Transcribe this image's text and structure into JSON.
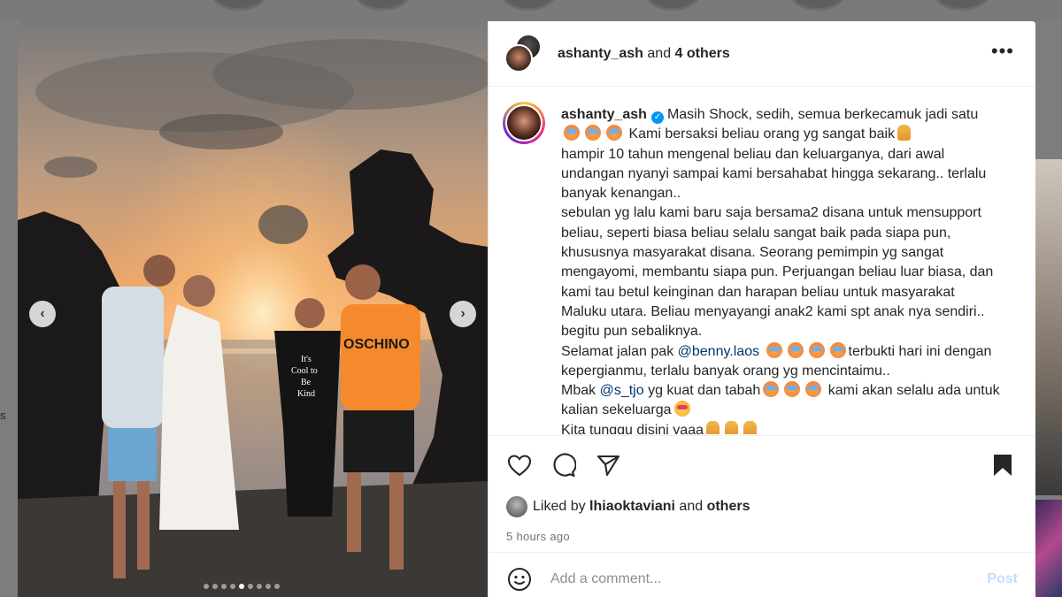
{
  "header": {
    "username": "ashanty_ash",
    "connector": "and",
    "others": "4 others",
    "more_label": "•••"
  },
  "photo": {
    "shirt_text": "It's Cool to Be Kind",
    "shirt2_text": "MOSCHINO",
    "prev_label": "‹",
    "next_label": "›",
    "carousel_dots": 9,
    "active_dot": 5
  },
  "caption": {
    "username": "ashanty_ash",
    "verified_mark": "✓",
    "line1": "Masih Shock, sedih, semua berkecamuk jadi satu",
    "line2": "Kami bersaksi beliau orang yg sangat baik",
    "line3": "hampir 10 tahun mengenal beliau dan keluarganya, dari awal undangan nyanyi sampai kami bersahabat hingga sekarang.. terlalu banyak kenangan..",
    "line4": "sebulan yg lalu kami baru saja bersama2 disana untuk mensupport beliau, seperti biasa beliau selalu sangat baik pada siapa pun, khususnya masyarakat disana. Seorang pemimpin yg sangat mengayomi, membantu siapa pun. Perjuangan beliau luar biasa, dan kami tau betul keinginan dan harapan beliau untuk masyarakat Maluku utara. Beliau menyayangi anak2 kami spt anak nya sendiri.. begitu pun sebaliknya.",
    "line5a": "Selamat jalan pak",
    "mention1": "@benny.laos",
    "line5b": "terbukti hari ini dengan kepergianmu, terlalu banyak orang yg mencintaimu..",
    "line6a": "Mbak",
    "mention2": "@s_tjo",
    "line6b": "yg kuat dan tabah",
    "line6c": "kami akan selalu ada untuk kalian sekeluarga",
    "line7": "Kita tunggu disini yaaa"
  },
  "actions": {
    "liked_prefix": "Liked by",
    "liked_user": "lhiaoktaviani",
    "liked_and": "and",
    "liked_others": "others",
    "timestamp": "5 hours ago"
  },
  "comment": {
    "placeholder": "Add a comment...",
    "post_label": "Post"
  },
  "icons": [
    "heart-icon",
    "comment-icon",
    "share-icon",
    "bookmark-icon",
    "emoji-icon",
    "more-options-icon",
    "verified-badge-icon"
  ],
  "colors": {
    "verified": "#0095f6",
    "mention": "#00376b",
    "post_disabled": "#c0dffd",
    "muted": "#737373"
  }
}
